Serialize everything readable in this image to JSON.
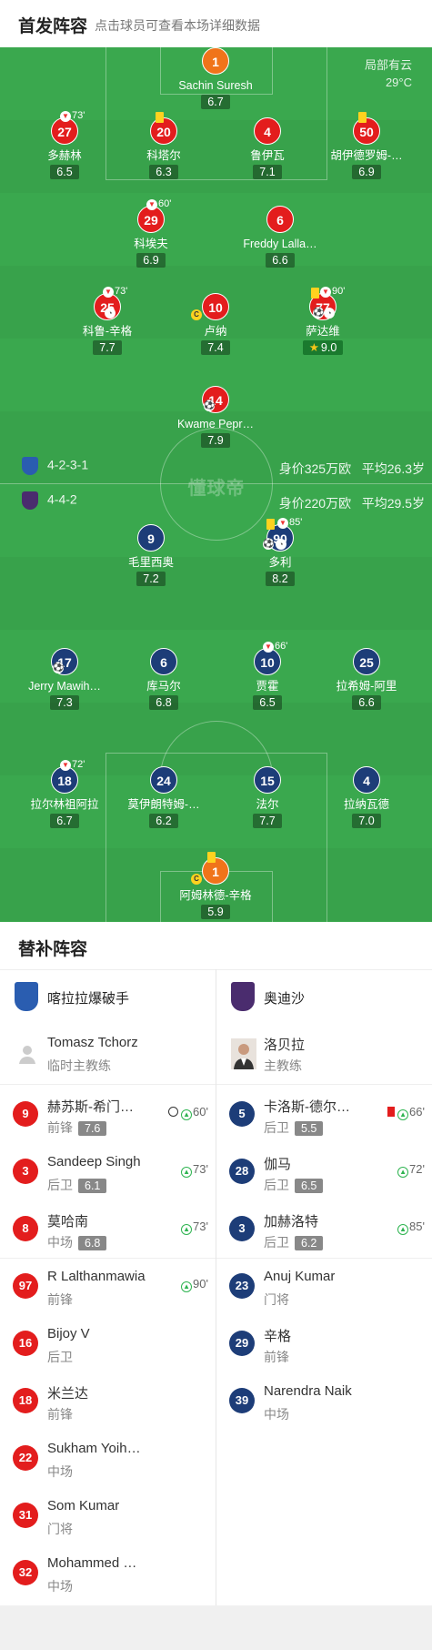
{
  "header": {
    "title": "首发阵容",
    "hint": "点击球员可查看本场详细数据"
  },
  "weather": {
    "condition": "局部有云",
    "temp": "29°C"
  },
  "watermark": "懂球帝",
  "home_team": {
    "formation": "4-2-3-1",
    "value": "身价325万欧",
    "avg_age": "平均26.3岁"
  },
  "away_team": {
    "formation": "4-4-2",
    "value": "身价220万欧",
    "avg_age": "平均29.5岁"
  },
  "home_lineup": [
    {
      "num": "1",
      "name": "Sachin Suresh",
      "rating": "6.7"
    },
    {
      "num": "27",
      "name": "多赫林",
      "rating": "6.5",
      "sub": "73'"
    },
    {
      "num": "20",
      "name": "科塔尔",
      "rating": "6.3"
    },
    {
      "num": "4",
      "name": "鲁伊瓦",
      "rating": "7.1"
    },
    {
      "num": "50",
      "name": "胡伊德罗姆-…",
      "rating": "6.9"
    },
    {
      "num": "29",
      "name": "科埃夫",
      "rating": "6.9",
      "sub": "60'"
    },
    {
      "num": "6",
      "name": "Freddy Lalla…",
      "rating": "6.6"
    },
    {
      "num": "25",
      "name": "科鲁-辛格",
      "rating": "7.7",
      "sub": "73'"
    },
    {
      "num": "10",
      "name": "卢纳",
      "rating": "7.4"
    },
    {
      "num": "77",
      "name": "萨达维",
      "rating": "9.0",
      "sub": "90'"
    },
    {
      "num": "14",
      "name": "Kwame Pepr…",
      "rating": "7.9"
    }
  ],
  "away_lineup": [
    {
      "num": "9",
      "name": "毛里西奥",
      "rating": "7.2"
    },
    {
      "num": "90",
      "name": "多利",
      "rating": "8.2",
      "sub": "85'"
    },
    {
      "num": "17",
      "name": "Jerry Mawih…",
      "rating": "7.3"
    },
    {
      "num": "6",
      "name": "库马尔",
      "rating": "6.8"
    },
    {
      "num": "10",
      "name": "贾霍",
      "rating": "6.5",
      "sub": "66'"
    },
    {
      "num": "25",
      "name": "拉希姆-阿里",
      "rating": "6.6"
    },
    {
      "num": "18",
      "name": "拉尔林祖阿拉",
      "rating": "6.7",
      "sub": "72'"
    },
    {
      "num": "24",
      "name": "莫伊朗特姆-…",
      "rating": "6.2"
    },
    {
      "num": "15",
      "name": "法尔",
      "rating": "7.7"
    },
    {
      "num": "4",
      "name": "拉纳瓦德",
      "rating": "7.0"
    },
    {
      "num": "1",
      "name": "阿姆林德-辛格",
      "rating": "5.9"
    }
  ],
  "bench": {
    "title": "替补阵容",
    "home": {
      "team": "喀拉拉爆破手",
      "coach": "Tomasz Tchorz",
      "coach_role": "临时主教练",
      "players": [
        {
          "num": "9",
          "name": "赫苏斯-希门…",
          "pos": "前锋",
          "rating": "7.6",
          "event": "60'"
        },
        {
          "num": "3",
          "name": "Sandeep Singh",
          "pos": "后卫",
          "rating": "6.1",
          "event": "73'"
        },
        {
          "num": "8",
          "name": "莫哈南",
          "pos": "中场",
          "rating": "6.8",
          "event": "73'"
        },
        {
          "num": "97",
          "name": "R Lalthanmawia",
          "pos": "前锋",
          "rating": "",
          "event": "90'"
        },
        {
          "num": "16",
          "name": "Bijoy V",
          "pos": "后卫",
          "rating": "",
          "event": ""
        },
        {
          "num": "18",
          "name": "米兰达",
          "pos": "前锋",
          "rating": "",
          "event": ""
        },
        {
          "num": "22",
          "name": "Sukham Yoih…",
          "pos": "中场",
          "rating": "",
          "event": ""
        },
        {
          "num": "31",
          "name": "Som Kumar",
          "pos": "门将",
          "rating": "",
          "event": ""
        },
        {
          "num": "32",
          "name": "Mohammed …",
          "pos": "中场",
          "rating": "",
          "event": ""
        }
      ]
    },
    "away": {
      "team": "奥迪沙",
      "coach": "洛贝拉",
      "coach_role": "主教练",
      "players": [
        {
          "num": "5",
          "name": "卡洛斯-德尔…",
          "pos": "后卫",
          "rating": "5.5",
          "event": "66'"
        },
        {
          "num": "28",
          "name": "伽马",
          "pos": "后卫",
          "rating": "6.5",
          "event": "72'"
        },
        {
          "num": "3",
          "name": "加赫洛特",
          "pos": "后卫",
          "rating": "6.2",
          "event": "85'"
        },
        {
          "num": "23",
          "name": "Anuj Kumar",
          "pos": "门将",
          "rating": "",
          "event": ""
        },
        {
          "num": "29",
          "name": "辛格",
          "pos": "前锋",
          "rating": "",
          "event": ""
        },
        {
          "num": "39",
          "name": "Narendra Naik",
          "pos": "中场",
          "rating": "",
          "event": ""
        }
      ]
    }
  },
  "colors": {
    "home": "#e31d1d",
    "away": "#1d3d78",
    "gk": "#f0741a",
    "pitch": "#3aa84e"
  }
}
